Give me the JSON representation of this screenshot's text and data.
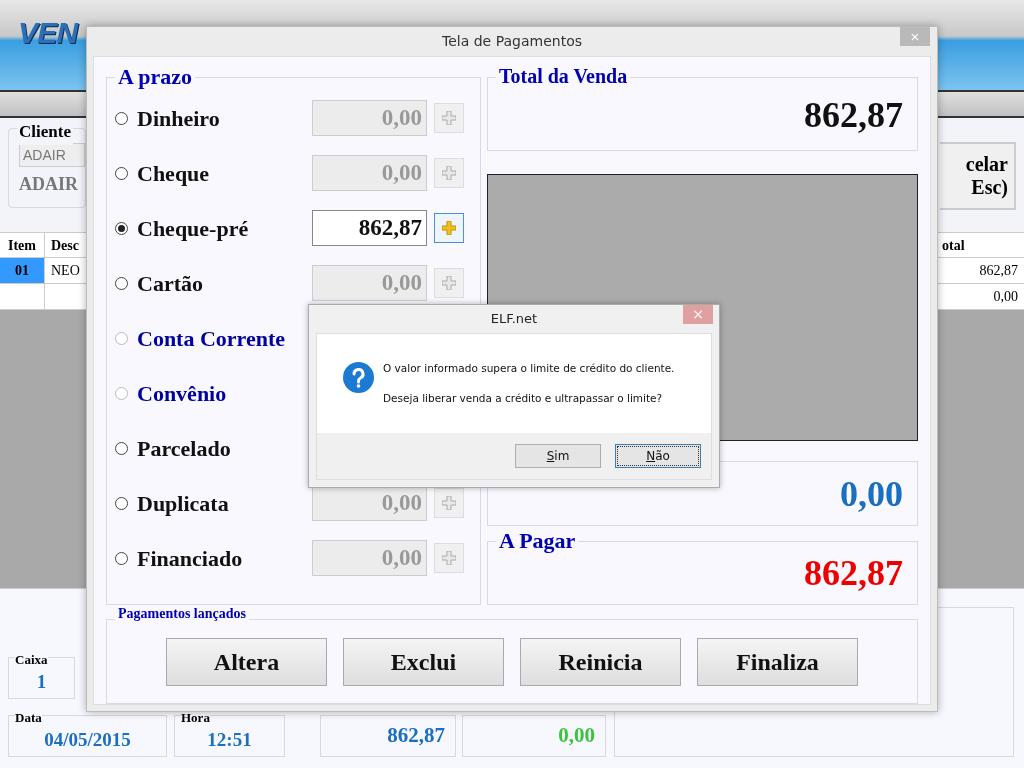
{
  "app": {
    "logo": "VEN",
    "client": {
      "label": "Cliente",
      "field_value": "ADAIR",
      "name": "ADAIR"
    },
    "cancel_button": {
      "lines": [
        "celar",
        "Esc)"
      ]
    },
    "table": {
      "columns": [
        "Item",
        "Desc",
        "otal"
      ],
      "rows": [
        {
          "item": "01",
          "description": "NEO",
          "total": "862,87",
          "selected": true
        },
        {
          "total": "0,00",
          "selected": false
        }
      ]
    },
    "status": {
      "caixa": {
        "label": "Caixa",
        "value": "1"
      },
      "data": {
        "label": "Data",
        "value": "04/05/2015"
      },
      "hora": {
        "label": "Hora",
        "value": "12:51"
      },
      "paid": "862,87",
      "change": "0,00"
    }
  },
  "payment_window": {
    "title": "Tela de Pagamentos",
    "close": "×",
    "group_title": "A prazo",
    "options": [
      {
        "label": "Dinheiro",
        "selected": false,
        "disabled": false,
        "amount": "0,00"
      },
      {
        "label": "Cheque",
        "selected": false,
        "disabled": false,
        "amount": "0,00"
      },
      {
        "label": "Cheque-pré",
        "selected": true,
        "disabled": false,
        "amount": "862,87"
      },
      {
        "label": "Cartão",
        "selected": false,
        "disabled": false,
        "amount": "0,00"
      },
      {
        "label": "Conta Corrente",
        "selected": false,
        "disabled": true
      },
      {
        "label": "Convênio",
        "selected": false,
        "disabled": true
      },
      {
        "label": "Parcelado",
        "selected": false,
        "disabled": false
      },
      {
        "label": "Duplicata",
        "selected": false,
        "disabled": false,
        "amount": "0,00"
      },
      {
        "label": "Financiado",
        "selected": false,
        "disabled": false,
        "amount": "0,00"
      }
    ],
    "total": {
      "title": "Total da Venda",
      "value": "862,87"
    },
    "paid_value": "0,00",
    "to_pay": {
      "title": "A Pagar",
      "value": "862,87"
    },
    "payments_title": "Pagamentos lançados",
    "buttons": [
      "Altera",
      "Exclui",
      "Reinicia",
      "Finaliza"
    ]
  },
  "message_box": {
    "title": "ELF.net",
    "close": "×",
    "lines": [
      "O valor informado supera o limite de crédito do cliente.",
      "Deseja liberar venda a crédito e ultrapassar o limite?"
    ],
    "buttons": [
      {
        "label": "Sim",
        "focused": false
      },
      {
        "label": "Não",
        "focused": true
      }
    ]
  }
}
